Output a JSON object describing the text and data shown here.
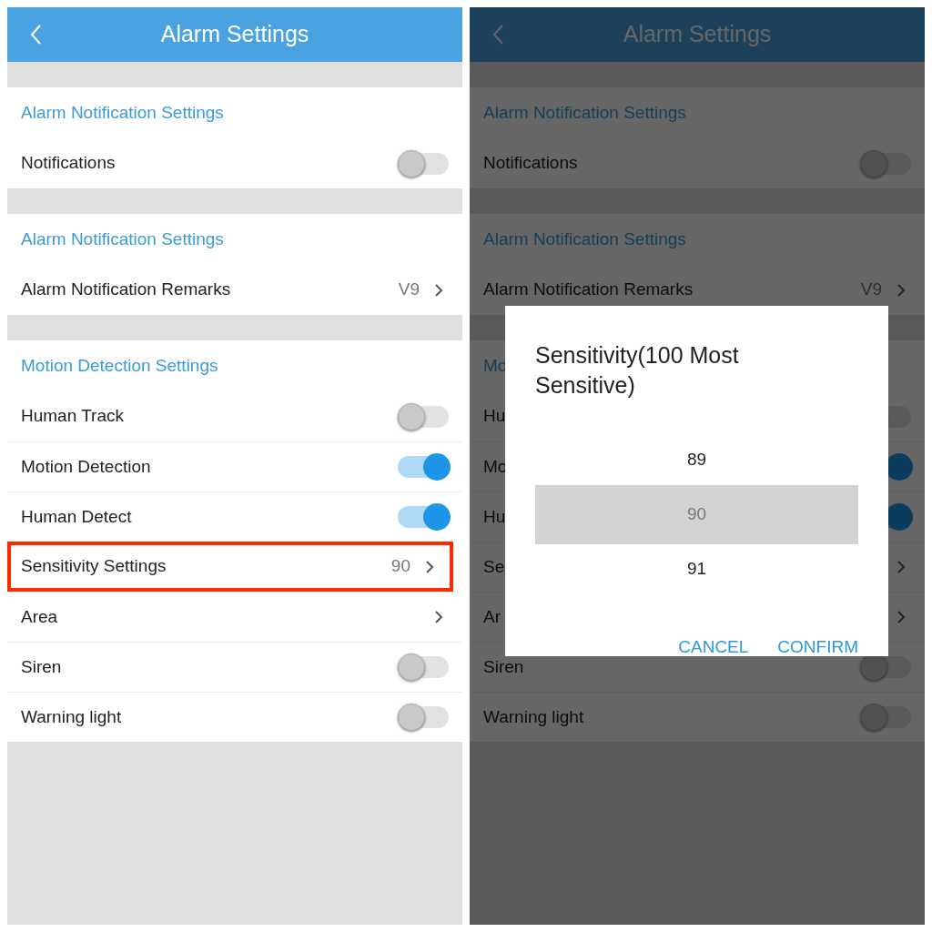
{
  "screens": [
    {
      "dimmed": false,
      "header": {
        "title": "Alarm Settings"
      },
      "sections": [
        {
          "title": "Alarm Notification Settings",
          "rows": [
            {
              "kind": "toggle",
              "label": "Notifications",
              "on": false,
              "highlighted": false
            }
          ]
        },
        {
          "title": "Alarm Notification Settings",
          "rows": [
            {
              "kind": "link",
              "label": "Alarm Notification Remarks",
              "value": "V9",
              "highlighted": false
            }
          ]
        },
        {
          "title": "Motion Detection Settings",
          "rows": [
            {
              "kind": "toggle",
              "label": "Human Track",
              "on": false,
              "highlighted": false
            },
            {
              "kind": "toggle",
              "label": "Motion Detection",
              "on": true,
              "highlighted": false
            },
            {
              "kind": "toggle",
              "label": "Human Detect",
              "on": true,
              "highlighted": false
            },
            {
              "kind": "link",
              "label": "Sensitivity Settings",
              "value": "90",
              "highlighted": true
            },
            {
              "kind": "link",
              "label": "Area",
              "highlighted": false
            },
            {
              "kind": "toggle",
              "label": "Siren",
              "on": false,
              "highlighted": false
            },
            {
              "kind": "toggle",
              "label": "Warning light",
              "on": false,
              "highlighted": false
            }
          ]
        }
      ]
    },
    {
      "dimmed": true,
      "header": {
        "title": "Alarm Settings"
      },
      "sections": [
        {
          "title": "Alarm Notification Settings",
          "rows": [
            {
              "kind": "toggle",
              "label": "Notifications",
              "on": false
            }
          ]
        },
        {
          "title": "Alarm Notification Settings",
          "rows": [
            {
              "kind": "link",
              "label": "Alarm Notification Remarks",
              "value": "V9"
            }
          ]
        },
        {
          "title": "Mo",
          "rows": [
            {
              "kind": "toggle",
              "label": "Hu",
              "on": false
            },
            {
              "kind": "toggle",
              "label": "Mo",
              "on": true
            },
            {
              "kind": "toggle",
              "label": "Hu",
              "on": true
            },
            {
              "kind": "link",
              "label": "Se"
            },
            {
              "kind": "link",
              "label": "Ar"
            },
            {
              "kind": "toggle",
              "label": "Siren",
              "on": false
            },
            {
              "kind": "toggle",
              "label": "Warning light",
              "on": false
            }
          ]
        }
      ],
      "dialog": {
        "title": "Sensitivity(100 Most Sensitive)",
        "options": [
          {
            "label": "89",
            "selected": false
          },
          {
            "label": "90",
            "selected": true
          },
          {
            "label": "91",
            "selected": false
          }
        ],
        "buttons": [
          "CANCEL",
          "CONFIRM"
        ]
      }
    }
  ]
}
